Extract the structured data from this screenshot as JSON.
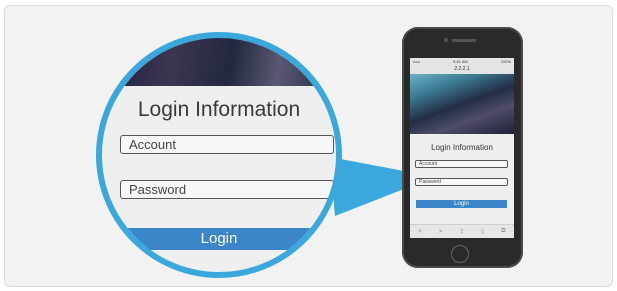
{
  "magnifier": {
    "title": "Login Information",
    "account_field": "Account",
    "password_field": "Password",
    "login_button": "Login"
  },
  "phone": {
    "status_left": "•••••",
    "status_time": "9:41 AM",
    "status_right": "100%",
    "url": "2.2.2.1",
    "title": "Login Information",
    "account_field": "Account",
    "password_field": "Password",
    "login_button": "Login",
    "toolbar": [
      "<",
      ">",
      "⇪",
      "▯",
      "⧉"
    ]
  },
  "colors": {
    "accent_blue": "#3aa8dc",
    "button_blue": "#3a86c8",
    "panel_bg": "#f2f2f2"
  }
}
